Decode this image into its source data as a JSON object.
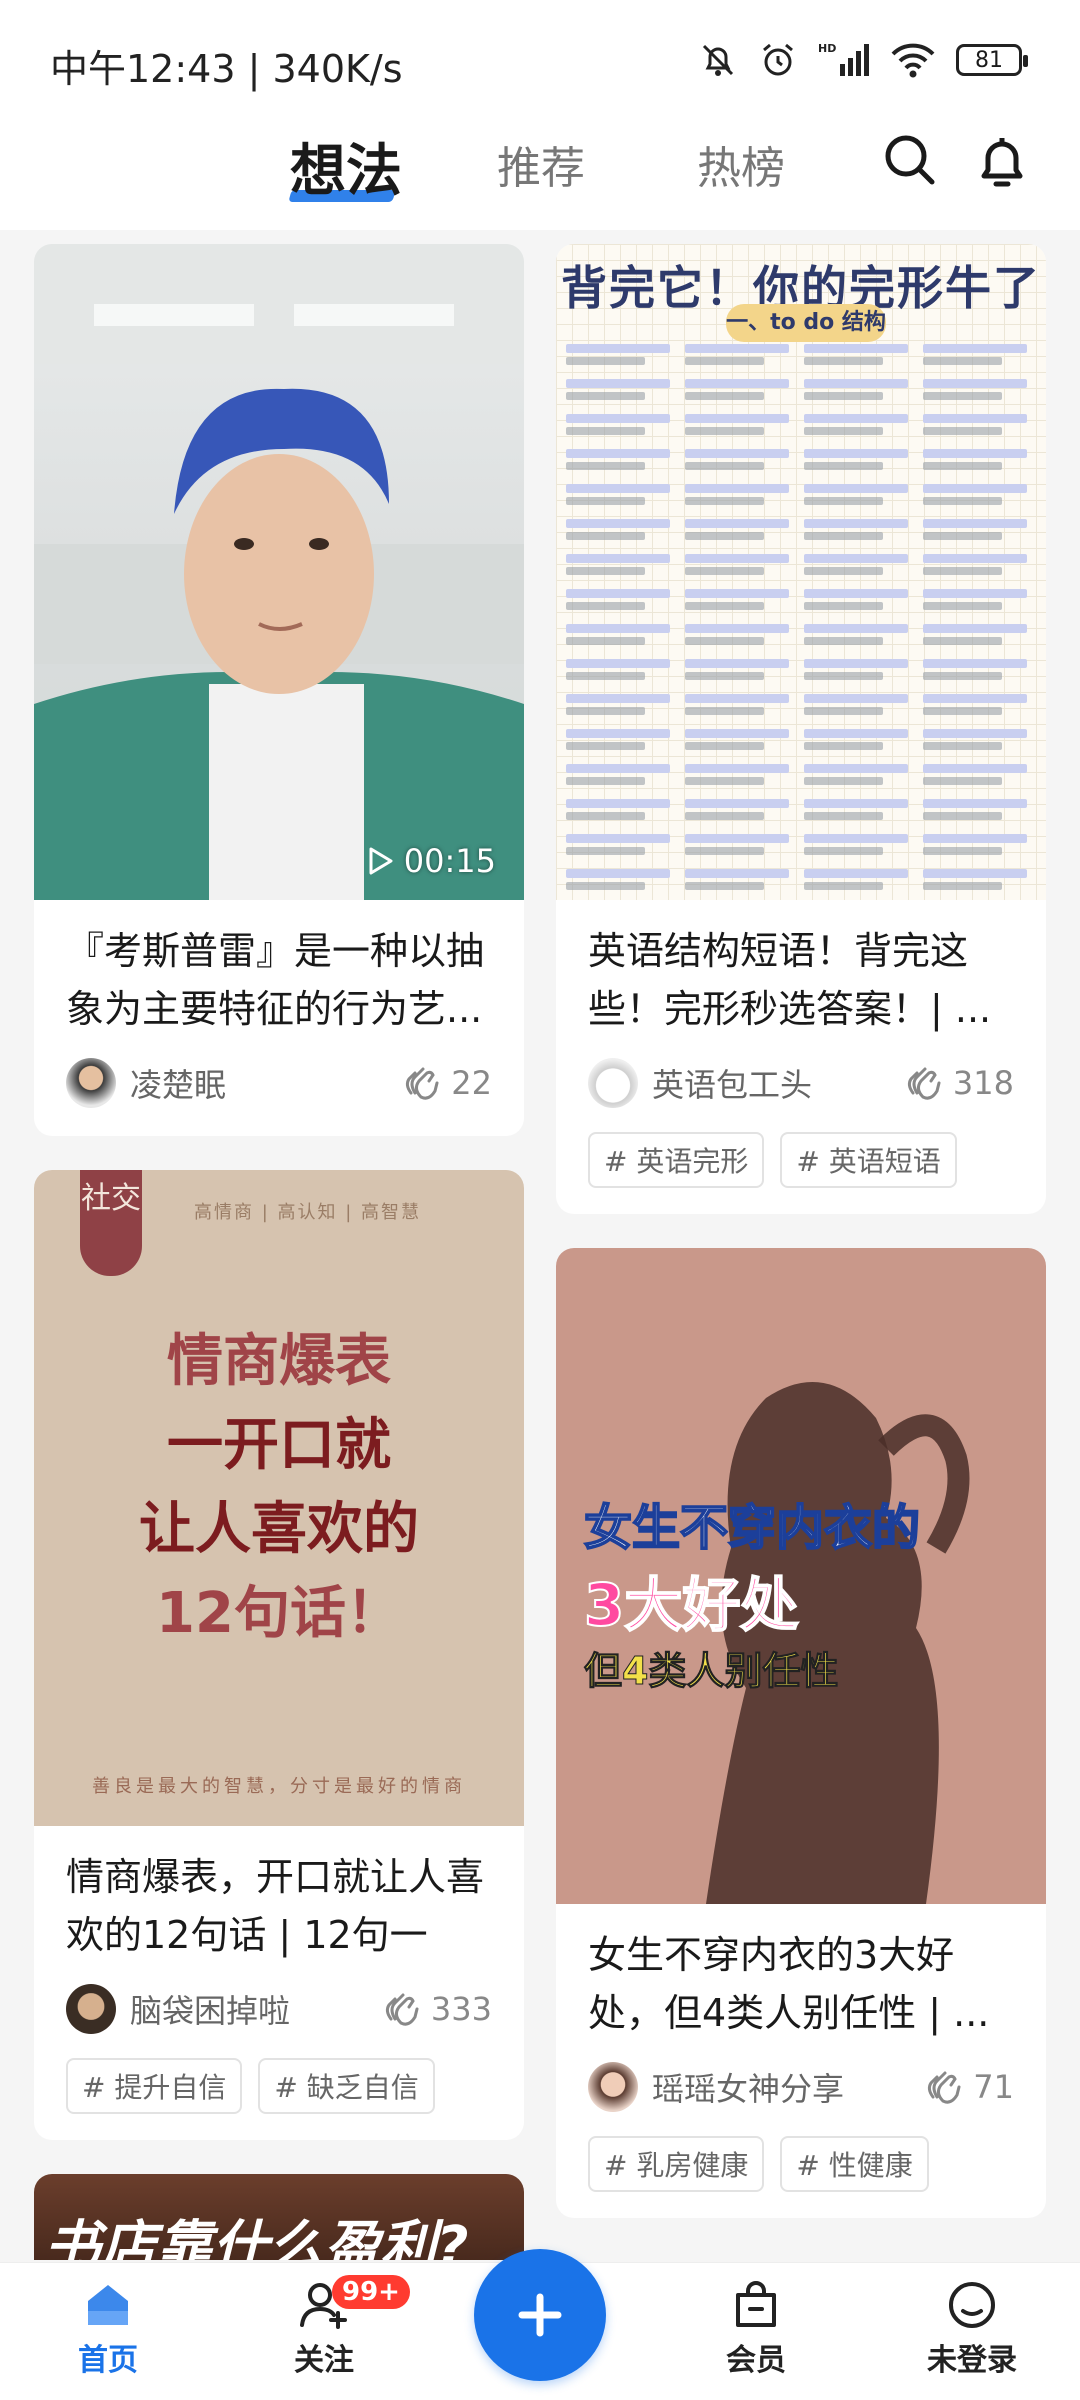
{
  "status_bar": {
    "time_speed": "中午12:43 | 340K/s",
    "battery": "81"
  },
  "top_nav": {
    "tabs": [
      {
        "label": "想法",
        "active": true
      },
      {
        "label": "推荐",
        "active": false
      },
      {
        "label": "热榜",
        "active": false
      }
    ]
  },
  "feed": {
    "cards": [
      {
        "title": "『考斯普雷』是一种以抽象为主要特征的行为艺...",
        "author": "凌楚眠",
        "likes": "22",
        "video_duration": "00:15",
        "tags": []
      },
      {
        "title": "英语结构短语！背完这些！完形秒选答案！| ...",
        "author": "英语包工头",
        "likes": "318",
        "image_title": "背完它！你的完形牛了",
        "image_subtitle": "一、to do 结构",
        "tags": [
          "# 英语完形",
          "# 英语短语"
        ]
      },
      {
        "title": "情商爆表，开口就让人喜欢的12句话 | 12句一开...",
        "author": "脑袋困掉啦",
        "likes": "333",
        "image_badge": "社交",
        "image_header": "高情商 | 高认知 | 高智慧",
        "image_lines": [
          "情商爆表",
          "一开口就",
          "让人喜欢的",
          "12句话！"
        ],
        "image_footer": "善良是最大的智慧，分寸是最好的情商",
        "tags": [
          "# 提升自信",
          "# 缺乏自信"
        ]
      },
      {
        "title": "女生不穿内衣的3大好处，但4类人别任性 | ...",
        "author": "瑶瑶女神分享",
        "likes": "71",
        "image_lines": [
          "女生不穿内衣的",
          "3大好处",
          "但4类人别任性"
        ],
        "tags": [
          "# 乳房健康",
          "# 性健康"
        ]
      },
      {
        "image_text": "书店靠什么盈利?"
      }
    ]
  },
  "bottom_nav": {
    "items": [
      {
        "label": "首页",
        "active": true
      },
      {
        "label": "关注",
        "badge": "99+"
      },
      {
        "label": "会员"
      },
      {
        "label": "未登录"
      }
    ]
  },
  "colors": {
    "accent": "#1a73e8",
    "badge": "#ff3b30"
  }
}
